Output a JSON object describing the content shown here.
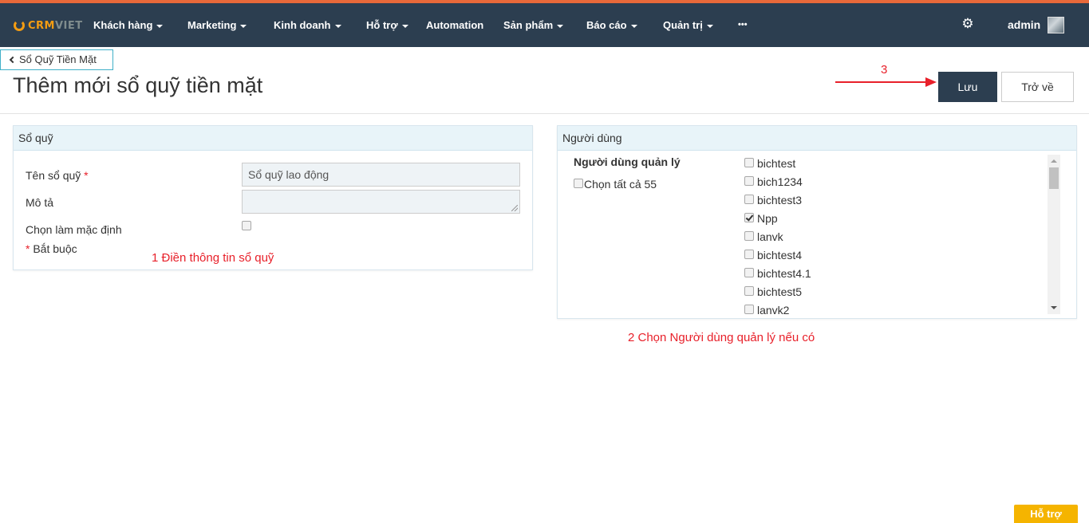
{
  "app": {
    "logo_text_a": "CRM",
    "logo_text_b": "VIET",
    "accent_color": "#e8693a",
    "navbar_color": "#2c3e50"
  },
  "nav": {
    "items": [
      {
        "label": "Khách hàng",
        "caret": true
      },
      {
        "label": "Marketing",
        "caret": true
      },
      {
        "label": "Kinh doanh",
        "caret": true
      },
      {
        "label": "Hỗ trợ",
        "caret": true
      },
      {
        "label": "Automation",
        "caret": false
      },
      {
        "label": "Sản phẩm",
        "caret": true
      },
      {
        "label": "Báo cáo",
        "caret": true
      },
      {
        "label": "Quản trị",
        "caret": true
      },
      {
        "label": "•••",
        "caret": false
      }
    ],
    "settings_icon": "gear-icon",
    "user_name": "admin"
  },
  "header": {
    "back_label": "Sổ Quỹ Tiền Mặt",
    "title": "Thêm mới sổ quỹ tiền mặt",
    "save_label": "Lưu",
    "return_label": "Trở về"
  },
  "annotations": {
    "step1": "1  Điền thông tin sổ quỹ",
    "step2": "2  Chọn Người dùng quản lý nếu có",
    "step3": "3"
  },
  "fund_panel": {
    "title": "Sổ quỹ",
    "name_label": "Tên sổ quỹ",
    "name_required_mark": "*",
    "name_value": "Sổ quỹ lao động",
    "desc_label": "Mô tả",
    "desc_value": "",
    "default_label": "Chọn làm mặc định",
    "default_checked": false,
    "required_mark": "*",
    "required_note": "Bắt buộc"
  },
  "user_panel": {
    "title": "Người dùng",
    "manager_label": "Người dùng quản lý",
    "select_all_label": "Chọn tất cả 55",
    "users": [
      {
        "name": "bichtest",
        "checked": false
      },
      {
        "name": "bich1234",
        "checked": false
      },
      {
        "name": "bichtest3",
        "checked": false
      },
      {
        "name": "Npp",
        "checked": true
      },
      {
        "name": "lanvk",
        "checked": false
      },
      {
        "name": "bichtest4",
        "checked": false
      },
      {
        "name": "bichtest4.1",
        "checked": false
      },
      {
        "name": "bichtest5",
        "checked": false
      },
      {
        "name": "lanvk2",
        "checked": false
      }
    ]
  },
  "support": {
    "label": "Hỗ trợ",
    "color": "#f5b400"
  }
}
